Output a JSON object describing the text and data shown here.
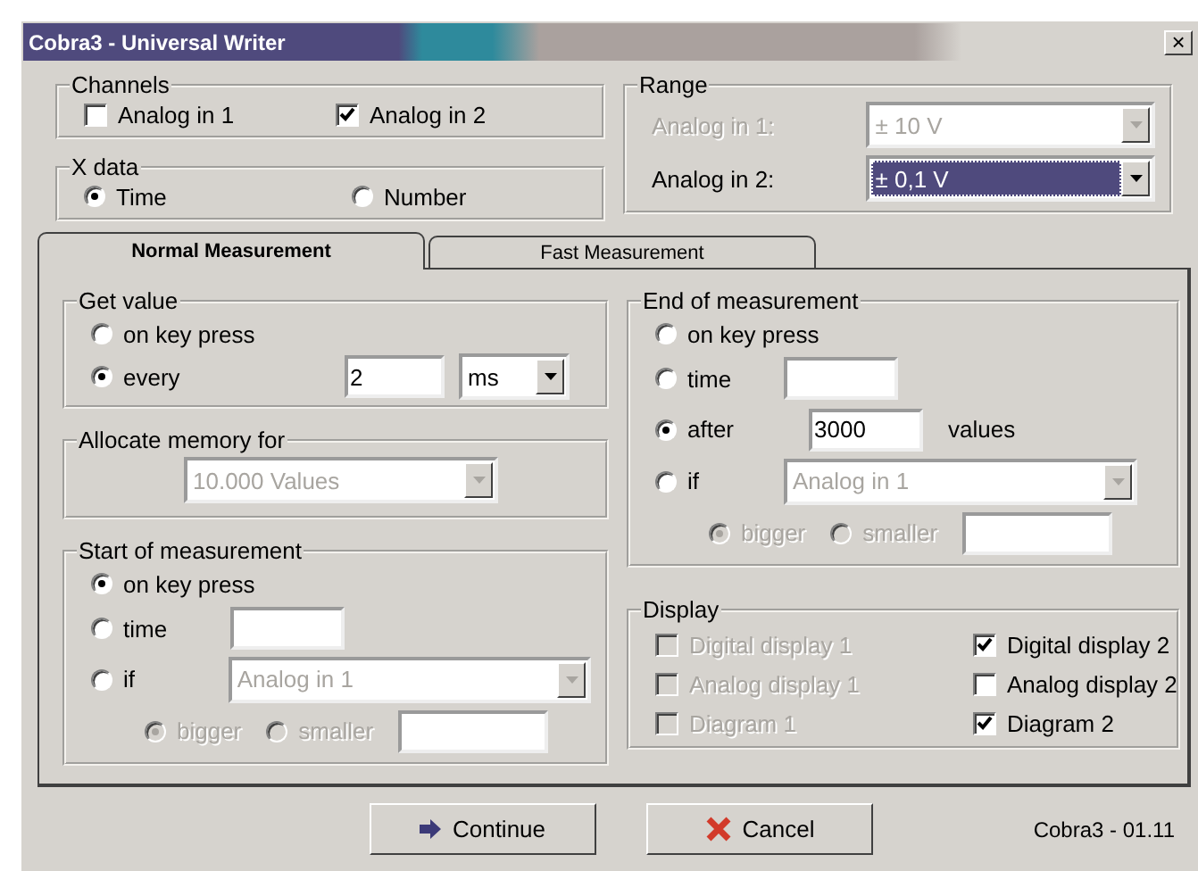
{
  "window": {
    "title": "Cobra3 - Universal Writer",
    "close": "×"
  },
  "channels": {
    "title": "Channels",
    "items": [
      {
        "label": "Analog in 1",
        "checked": false
      },
      {
        "label": "Analog in 2",
        "checked": true
      }
    ]
  },
  "x_data": {
    "title": "X data",
    "options": [
      {
        "label": "Time",
        "selected": true
      },
      {
        "label": "Number",
        "selected": false
      }
    ]
  },
  "range": {
    "title": "Range",
    "rows": [
      {
        "label": "Analog in 1:",
        "value": "± 10 V",
        "disabled": true,
        "focused": false
      },
      {
        "label": "Analog in 2:",
        "value": "± 0,1 V",
        "disabled": false,
        "focused": true
      }
    ]
  },
  "tabs": [
    {
      "label": "Normal Measurement",
      "selected": true
    },
    {
      "label": "Fast Measurement",
      "selected": false
    }
  ],
  "get_value": {
    "title": "Get value",
    "options": [
      {
        "label": "on key press",
        "selected": false
      },
      {
        "label": "every",
        "selected": true
      }
    ],
    "interval": "2",
    "unit": "ms"
  },
  "allocate_memory": {
    "title": "Allocate memory for",
    "value": "10.000 Values",
    "disabled": true
  },
  "start": {
    "title": "Start of measurement",
    "options": [
      {
        "label": "on key press",
        "selected": true,
        "kind": "plain"
      },
      {
        "label": "time",
        "selected": false,
        "kind": "field"
      },
      {
        "label": "if",
        "selected": false,
        "kind": "combo",
        "value": "Analog in 1"
      }
    ],
    "compare": {
      "disabled": true,
      "options": [
        {
          "label": "bigger",
          "selected": true
        },
        {
          "label": "smaller",
          "selected": false
        }
      ]
    }
  },
  "end": {
    "title": "End of measurement",
    "options": [
      {
        "label": "on key press",
        "selected": false,
        "kind": "plain"
      },
      {
        "label": "time",
        "selected": false,
        "kind": "field"
      },
      {
        "label": "after",
        "selected": true,
        "kind": "count",
        "value": "3000",
        "suffix": "values"
      },
      {
        "label": "if",
        "selected": false,
        "kind": "combo",
        "value": "Analog in 1"
      }
    ],
    "compare": {
      "disabled": true,
      "options": [
        {
          "label": "bigger",
          "selected": true
        },
        {
          "label": "smaller",
          "selected": false
        }
      ]
    }
  },
  "display": {
    "title": "Display",
    "items": [
      {
        "label": "Digital display 1",
        "checked": false,
        "disabled": true
      },
      {
        "label": "Digital display 2",
        "checked": true,
        "disabled": false
      },
      {
        "label": "Analog display 1",
        "checked": false,
        "disabled": true
      },
      {
        "label": "Analog display 2",
        "checked": false,
        "disabled": false
      },
      {
        "label": "Diagram 1",
        "checked": false,
        "disabled": true
      },
      {
        "label": "Diagram 2",
        "checked": true,
        "disabled": false
      }
    ]
  },
  "buttons": [
    {
      "label": "Continue"
    },
    {
      "label": "Cancel"
    }
  ],
  "version": "Cobra3 - 01.11"
}
